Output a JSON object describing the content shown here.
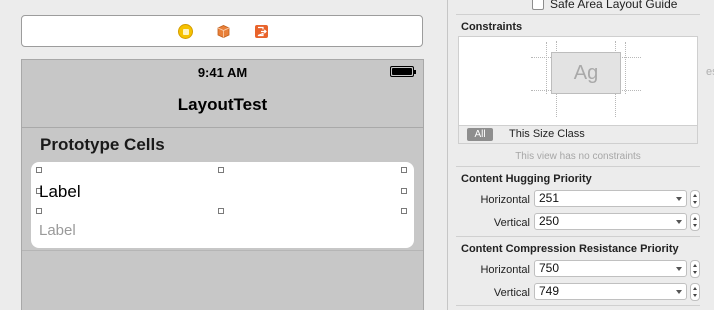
{
  "canvas": {
    "status_time": "9:41 AM",
    "nav_title": "LayoutTest",
    "section_header": "Prototype Cells",
    "cell": {
      "label_1": "Label",
      "label_2": "Label"
    },
    "dock_icons": [
      "view-controller-icon",
      "first-responder-icon",
      "exit-icon"
    ]
  },
  "inspector": {
    "safe_area_label": "Safe Area Layout Guide",
    "constraints_heading": "Constraints",
    "preview_text": "Ag",
    "size_class_all": "All",
    "size_class_label": "This Size Class",
    "no_constraints": "This view has no constraints",
    "hugging": {
      "heading": "Content Hugging Priority",
      "horizontal_label": "Horizontal",
      "horizontal_value": "251",
      "vertical_label": "Vertical",
      "vertical_value": "250"
    },
    "compression": {
      "heading": "Content Compression Resistance Priority",
      "horizontal_label": "Horizontal",
      "horizontal_value": "750",
      "vertical_label": "Vertical",
      "vertical_value": "749"
    },
    "edge_glyph": "es"
  },
  "colors": {
    "view_controller_icon": "#f6c200",
    "first_responder_icon": "#e8803a",
    "exit_icon": "#e8632b",
    "cell_background": "#ffffff",
    "table_background": "#c7c7c7"
  }
}
